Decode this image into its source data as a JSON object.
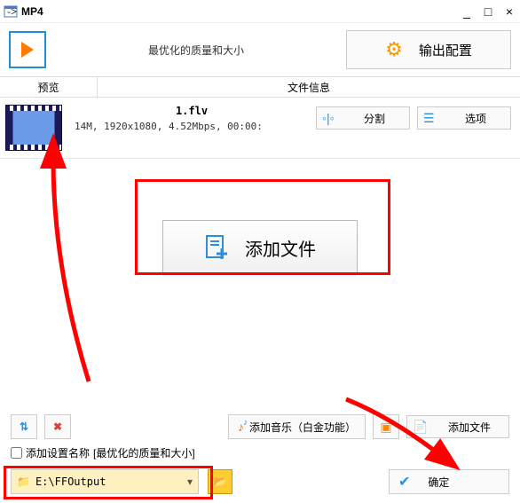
{
  "titlebar": {
    "format": "MP4"
  },
  "quality_label": "最优化的质量和大小",
  "output_config_btn": "输出配置",
  "columns": {
    "preview": "预览",
    "info": "文件信息"
  },
  "file": {
    "name": "1.flv",
    "meta": "14M, 1920x1080, 4.52Mbps, 00:00:",
    "split_btn": "分割",
    "options_btn": "选项"
  },
  "add_file_big": "添加文件",
  "add_music_btn": "添加音乐（白金功能）",
  "add_file_small": "添加文件",
  "settings_checkbox": "添加设置名称",
  "settings_suffix": "[最优化的质量和大小]",
  "output_path": "E:\\FFOutput",
  "confirm_btn": "确定"
}
